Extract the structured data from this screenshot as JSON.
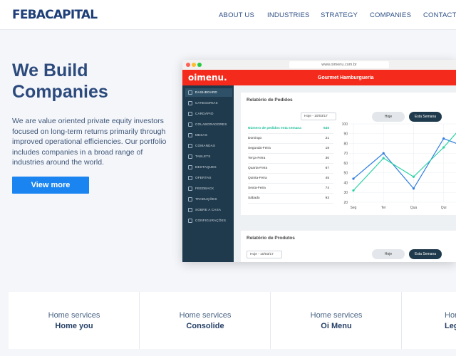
{
  "brand": {
    "logo": "FEBACAPITAL"
  },
  "nav": [
    {
      "label": "ABOUT US"
    },
    {
      "label": "INDUSTRIES"
    },
    {
      "label": "STRATEGY"
    },
    {
      "label": "COMPANIES"
    },
    {
      "label": "CONTACT US"
    }
  ],
  "hero": {
    "title": "We Build Companies",
    "text": "We are value oriented private equity investors focused on long-term returns primarily through improved operational efficiencies. Our portfolio includes companies in a broad range of industries around the world.",
    "cta": "View more"
  },
  "mock": {
    "url": "www.oimenu.com.br",
    "app_logo": "oimenu.",
    "app_title": "Gourmet Hamburgueria",
    "sidebar": [
      {
        "label": "DASHBOARD"
      },
      {
        "label": "CATEGORIAS"
      },
      {
        "label": "CARDÁPIO"
      },
      {
        "label": "COLABORADORES"
      },
      {
        "label": "MESAS"
      },
      {
        "label": "COMANDAS"
      },
      {
        "label": "TABLETS"
      },
      {
        "label": "DESTAQUES"
      },
      {
        "label": "OFERTAS"
      },
      {
        "label": "FEEDBACK"
      },
      {
        "label": "TRADUÇÕES"
      },
      {
        "label": "SOBRE A CASA"
      },
      {
        "label": "CONFIGURAÇÕES"
      }
    ],
    "orders": {
      "title": "Relatório de Pedidos",
      "date_select": "Hoje - 10/03/17",
      "today_button": "Hoje",
      "week_button": "Esta Semana",
      "rows": [
        {
          "label": "Número de pedidos esta semana",
          "value": "645"
        },
        {
          "label": "Domingo",
          "value": "21"
        },
        {
          "label": "Segunda-Feira",
          "value": "18"
        },
        {
          "label": "Terça-Feira",
          "value": "30"
        },
        {
          "label": "Quarta-Feira",
          "value": "67"
        },
        {
          "label": "Quinta-Feira",
          "value": "45"
        },
        {
          "label": "Sexta-Feira",
          "value": "74"
        },
        {
          "label": "Sábado",
          "value": "93"
        }
      ]
    },
    "products": {
      "title": "Relatório de Produtos",
      "date_select": "Hoje - 10/03/17",
      "today_button": "Hoje",
      "week_button": "Esta Semana"
    },
    "chart": {
      "y_ticks": [
        "100",
        "90",
        "80",
        "70",
        "60",
        "50",
        "40",
        "30",
        "20"
      ],
      "x_ticks": [
        "Seg",
        "Ter",
        "Qua",
        "Qui"
      ],
      "colors": {
        "series_a": "#2f7de1",
        "series_b": "#29d3a3"
      }
    }
  },
  "chart_data": {
    "type": "line",
    "categories": [
      "Seg",
      "Ter",
      "Qua",
      "Qui"
    ],
    "x": [
      0,
      1,
      2,
      3,
      3.6
    ],
    "series": [
      {
        "values": [
          44,
          70,
          34,
          85,
          78
        ]
      },
      {
        "values": [
          32,
          65,
          46,
          76,
          97
        ]
      }
    ],
    "ylim": [
      20,
      100
    ]
  },
  "services": [
    {
      "category": "Home services",
      "name": "Home you"
    },
    {
      "category": "Home services",
      "name": "Consolide"
    },
    {
      "category": "Home services",
      "name": "Oi Menu"
    },
    {
      "category": "Home services",
      "name": "Legal"
    }
  ]
}
